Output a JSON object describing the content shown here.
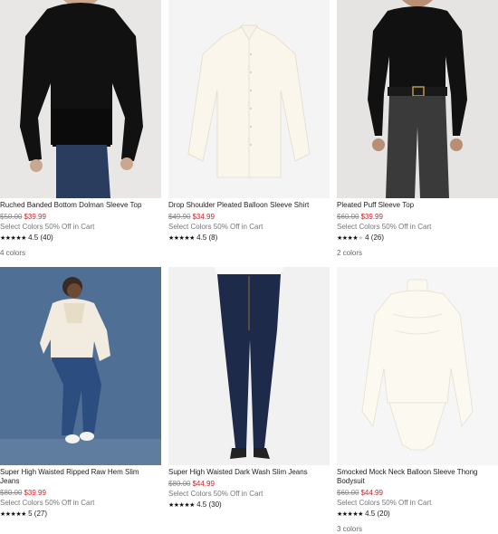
{
  "products": [
    {
      "name": "Ruched Banded Bottom Dolman Sleeve Top",
      "original_price": "$50.00",
      "sale_price": "$39.99",
      "promo": "Select Colors 50% Off in Cart",
      "stars": 4.5,
      "rating_text": "4.5 (40)",
      "colors": "4 colors"
    },
    {
      "name": "Drop Shoulder Pleated Balloon Sleeve Shirt",
      "original_price": "$49.90",
      "sale_price": "$34.99",
      "promo": "Select Colors 50% Off in Cart",
      "stars": 4.5,
      "rating_text": "4.5 (8)",
      "colors": ""
    },
    {
      "name": "Pleated Puff Sleeve Top",
      "original_price": "$60.00",
      "sale_price": "$39.99",
      "promo": "Select Colors 50% Off in Cart",
      "stars": 4,
      "rating_text": "4 (26)",
      "colors": "2 colors"
    },
    {
      "name": "Super High Waisted Ripped Raw Hem Slim Jeans",
      "original_price": "$80.00",
      "sale_price": "$39.99",
      "promo": "Select Colors 50% Off in Cart",
      "stars": 5,
      "rating_text": "5 (27)",
      "colors": ""
    },
    {
      "name": "Super High Waisted Dark Wash Slim Jeans",
      "original_price": "$80.00",
      "sale_price": "$44.99",
      "promo": "Select Colors 50% Off in Cart",
      "stars": 4.5,
      "rating_text": "4.5 (30)",
      "colors": ""
    },
    {
      "name": "Smocked Mock Neck Balloon Sleeve Thong Bodysuit",
      "original_price": "$60.00",
      "sale_price": "$44.99",
      "promo": "Select Colors 50% Off in Cart",
      "stars": 4.5,
      "rating_text": "4.5 (20)",
      "colors": "3 colors"
    }
  ],
  "colors": {
    "sale_red": "#d21f26",
    "original_gray": "#888888",
    "text_dark": "#222222"
  },
  "images": [
    "black-dolman-top-photo",
    "ivory-balloon-sleeve-shirt-photo",
    "black-puff-sleeve-top-photo",
    "ripped-slim-jeans-photo",
    "dark-wash-slim-jeans-photo",
    "ivory-mock-neck-bodysuit-photo"
  ]
}
